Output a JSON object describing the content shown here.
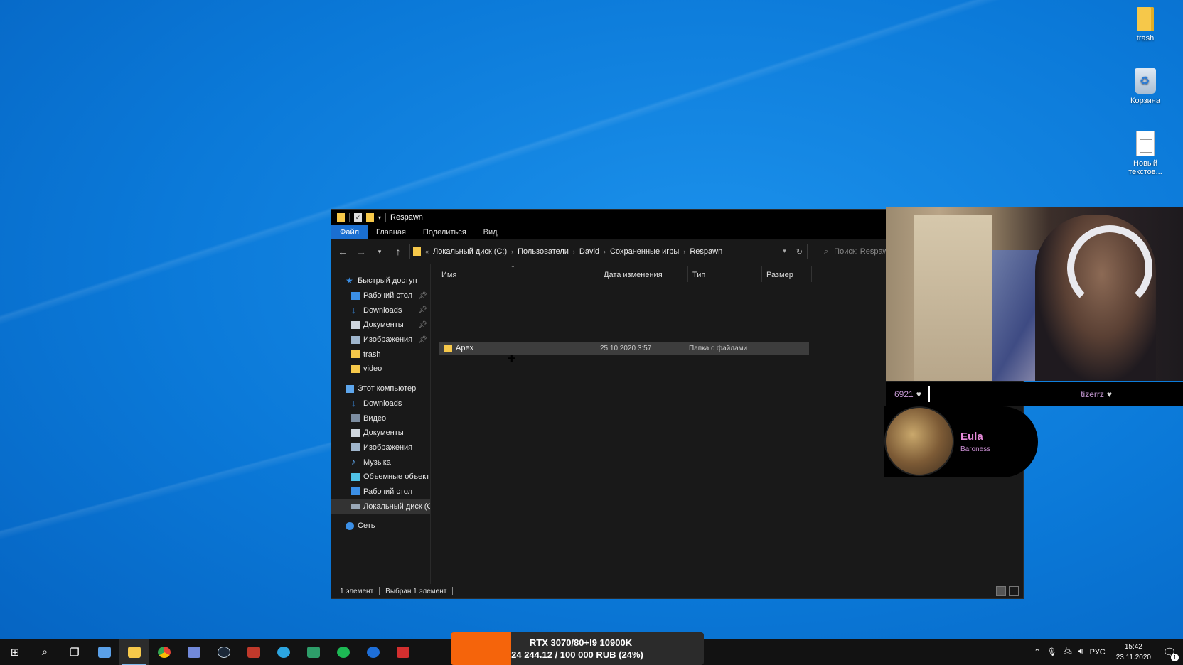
{
  "desktop": {
    "icons": [
      {
        "label": "trash",
        "icon": "folder-icon"
      },
      {
        "label": "Корзина",
        "icon": "recycle-bin-icon"
      },
      {
        "label": "Новый текстов...",
        "icon": "text-document-icon"
      }
    ]
  },
  "explorer": {
    "title": "Respawn",
    "ribbon_tabs": [
      "Файл",
      "Главная",
      "Поделиться",
      "Вид"
    ],
    "breadcrumb": [
      "Локальный диск (C:)",
      "Пользователи",
      "David",
      "Сохраненные игры",
      "Respawn"
    ],
    "breadcrumb_overflow": "«",
    "search_placeholder": "Поиск: Respawn",
    "nav": {
      "quick_access": "Быстрый доступ",
      "quick_items": [
        "Рабочий стол",
        "Downloads",
        "Документы",
        "Изображения",
        "trash",
        "video"
      ],
      "this_pc": "Этот компьютер",
      "pc_items": [
        "Downloads",
        "Видео",
        "Документы",
        "Изображения",
        "Музыка",
        "Объемные объекты",
        "Рабочий стол",
        "Локальный диск (C:)"
      ],
      "network": "Сеть"
    },
    "columns": [
      "Имя",
      "Дата изменения",
      "Тип",
      "Размер"
    ],
    "files": [
      {
        "name": "Apex",
        "date": "25.10.2020 3:57",
        "type": "Папка с файлами",
        "size": ""
      }
    ],
    "status": {
      "count": "1 элемент",
      "selected": "Выбран 1 элемент"
    }
  },
  "stream_overlay": {
    "left_counter": "6921",
    "right_counter": "tizerrz",
    "profile_name": "Eula",
    "profile_title": "Baroness"
  },
  "donation_bar": {
    "line1": "RTX 3070/80+I9 10900K",
    "line2": "24 244.12 / 100 000 RUB (24%)",
    "progress_fraction": 0.24,
    "color": "#f5640b"
  },
  "taskbar": {
    "apps": [
      "start-icon",
      "search-icon",
      "task-view-icon",
      "app-icon",
      "file-explorer-icon",
      "chrome-icon",
      "discord-icon",
      "steam-icon",
      "screen-record-icon",
      "telegram-icon",
      "app-green-icon",
      "spotify-icon",
      "app-blue-icon",
      "adobe-icon"
    ],
    "language": "РУС",
    "time": "15:42",
    "date": "23.11.2020",
    "notifications": "1"
  }
}
